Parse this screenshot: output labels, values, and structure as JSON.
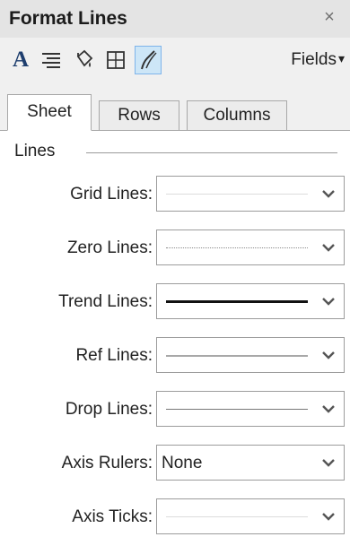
{
  "window": {
    "title": "Format Lines",
    "close_glyph": "×"
  },
  "toolbar": {
    "icons": [
      {
        "name": "font-icon",
        "active": false
      },
      {
        "name": "alignment-icon",
        "active": false
      },
      {
        "name": "shading-icon",
        "active": false
      },
      {
        "name": "borders-icon",
        "active": false
      },
      {
        "name": "lines-icon",
        "active": true
      }
    ],
    "fields_label": "Fields",
    "fields_caret": "▾"
  },
  "tabs": [
    {
      "label": "Sheet",
      "selected": true
    },
    {
      "label": "Rows",
      "selected": false
    },
    {
      "label": "Columns",
      "selected": false
    }
  ],
  "section": {
    "title": "Lines"
  },
  "rows": [
    {
      "label": "Grid Lines:",
      "line_style": "very-light-thin"
    },
    {
      "label": "Zero Lines:",
      "line_style": "dotted"
    },
    {
      "label": "Trend Lines:",
      "line_style": "thick-black"
    },
    {
      "label": "Ref Lines:",
      "line_style": "medium-gray"
    },
    {
      "label": "Drop Lines:",
      "line_style": "thin-gray"
    },
    {
      "label": "Axis Rulers:",
      "line_style": "none",
      "value": "None"
    },
    {
      "label": "Axis Ticks:",
      "line_style": "very-light-thin"
    }
  ],
  "colors": {
    "title_bar": "#e4e4e4",
    "toolbar": "#f0f0f0",
    "active_icon_bg": "#cde6f7",
    "active_icon_border": "#7eb4ea",
    "chevron": "#555555",
    "dropdown_border": "#9c9c9c"
  }
}
